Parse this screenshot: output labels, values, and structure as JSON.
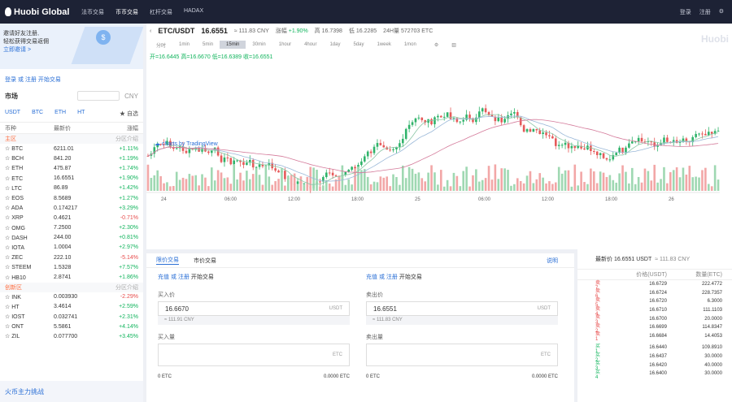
{
  "topbar": {
    "logo": "Huobi Global",
    "nav": [
      "法币交易",
      "币币交易",
      "杠杆交易",
      "HADAX"
    ],
    "active": 1,
    "login": "登录",
    "register": "注册"
  },
  "left": {
    "banner": {
      "line1": "邀请好友注册,",
      "line2": "轻松获得交易返佣",
      "link": "立即邀请 >"
    },
    "login_hint": "登录 或 注册 开始交易",
    "market_title": "市场",
    "currency": "CNY",
    "tabs": [
      "USDT",
      "BTC",
      "ETH",
      "HT"
    ],
    "favorite": "自选",
    "columns": [
      "币种",
      "最新价",
      "涨幅"
    ],
    "section_main": "主区",
    "section_note": "分区介绍",
    "rows": [
      [
        "BTC",
        "6211.01",
        "+1.11%"
      ],
      [
        "BCH",
        "841.20",
        "+1.19%"
      ],
      [
        "ETH",
        "475.87",
        "+1.74%"
      ],
      [
        "ETC",
        "16.6551",
        "+1.90%"
      ],
      [
        "LTC",
        "86.89",
        "+1.42%"
      ],
      [
        "EOS",
        "8.5689",
        "+1.27%"
      ],
      [
        "ADA",
        "0.174217",
        "+3.29%"
      ],
      [
        "XRP",
        "0.4621",
        "-0.71%"
      ],
      [
        "OMG",
        "7.2500",
        "+2.30%"
      ],
      [
        "DASH",
        "244.00",
        "+0.81%"
      ],
      [
        "IOTA",
        "1.0004",
        "+2.97%"
      ],
      [
        "ZEC",
        "222.10",
        "-5.14%"
      ],
      [
        "STEEM",
        "1.5328",
        "+7.57%"
      ],
      [
        "HB10",
        "2.8741",
        "+1.86%"
      ]
    ],
    "section_innov": "创新区",
    "rows2": [
      [
        "INK",
        "0.003930",
        "-2.29%"
      ],
      [
        "HT",
        "3.4614",
        "+2.59%"
      ],
      [
        "IOST",
        "0.032741",
        "+2.31%"
      ],
      [
        "ONT",
        "5.5861",
        "+4.14%"
      ],
      [
        "ZIL",
        "0.077700",
        "+3.45%"
      ]
    ],
    "activity": "火币主力挑战"
  },
  "header": {
    "symbol": "ETC/USDT",
    "price": "16.6551",
    "cny": "≈ 111.83 CNY",
    "change_label": "涨幅",
    "change": "+1.90%",
    "high": "高 16.7398",
    "low": "低 16.2285",
    "vol": "24H量 572703 ETC"
  },
  "watermark": "Huobi",
  "intervals": [
    "分时",
    "1min",
    "5min",
    "15min",
    "30min",
    "1hour",
    "4hour",
    "1day",
    "5day",
    "1week",
    "1mon"
  ],
  "active_interval": 3,
  "ohlc": "开=16.6445 高=16.6670 低=16.6389 收=16.6551",
  "tradingview": "charts by TradingView",
  "xticks": [
    "24",
    "06:00",
    "12:00",
    "18:00",
    "25",
    "06:00",
    "12:00",
    "18:00",
    "26",
    "06:00"
  ],
  "order": {
    "tabs": [
      "限价交易",
      "市价交易"
    ],
    "right": "说明",
    "buy": {
      "head": "充值 或 注册",
      "head_b": "开始交易",
      "price_label": "买入价",
      "price": "16.6670",
      "unit": "USDT",
      "hint": "≈ 111.91 CNY",
      "amount_label": "买入量",
      "amount_unit": "ETC",
      "foot_l": "0 ETC",
      "foot_r": "0.0000 ETC"
    },
    "sell": {
      "head": "充值 或 注册",
      "head_b": "开始交易",
      "price_label": "卖出价",
      "price": "16.6551",
      "unit": "USDT",
      "hint": "≈ 111.83 CNY",
      "amount_label": "卖出量",
      "amount_unit": "ETC",
      "foot_l": "0 ETC",
      "foot_r": "0.0000 ETC"
    }
  },
  "orderbook": {
    "head": "最新价 16.6551 USDT",
    "head_cny": "≈ 111.83 CNY",
    "cols": [
      "价格(USDT)",
      "数量(ETC)"
    ],
    "asks": [
      [
        "卖 7",
        "16.6729",
        "222.4772"
      ],
      [
        "卖 6",
        "16.6724",
        "228.7357"
      ],
      [
        "卖 5",
        "16.6720",
        "6.3000"
      ],
      [
        "卖 4",
        "16.6710",
        "111.1103"
      ],
      [
        "卖 3",
        "16.6700",
        "20.0000"
      ],
      [
        "卖 2",
        "16.6699",
        "114.8347"
      ],
      [
        "卖 1",
        "16.6684",
        "14.4053"
      ]
    ],
    "bids": [
      [
        "买 1",
        "16.6440",
        "109.8910"
      ],
      [
        "买 2",
        "16.6437",
        "30.0000"
      ],
      [
        "买 3",
        "16.6420",
        "40.0000"
      ],
      [
        "买 4",
        "16.6400",
        "30.0000"
      ]
    ]
  }
}
